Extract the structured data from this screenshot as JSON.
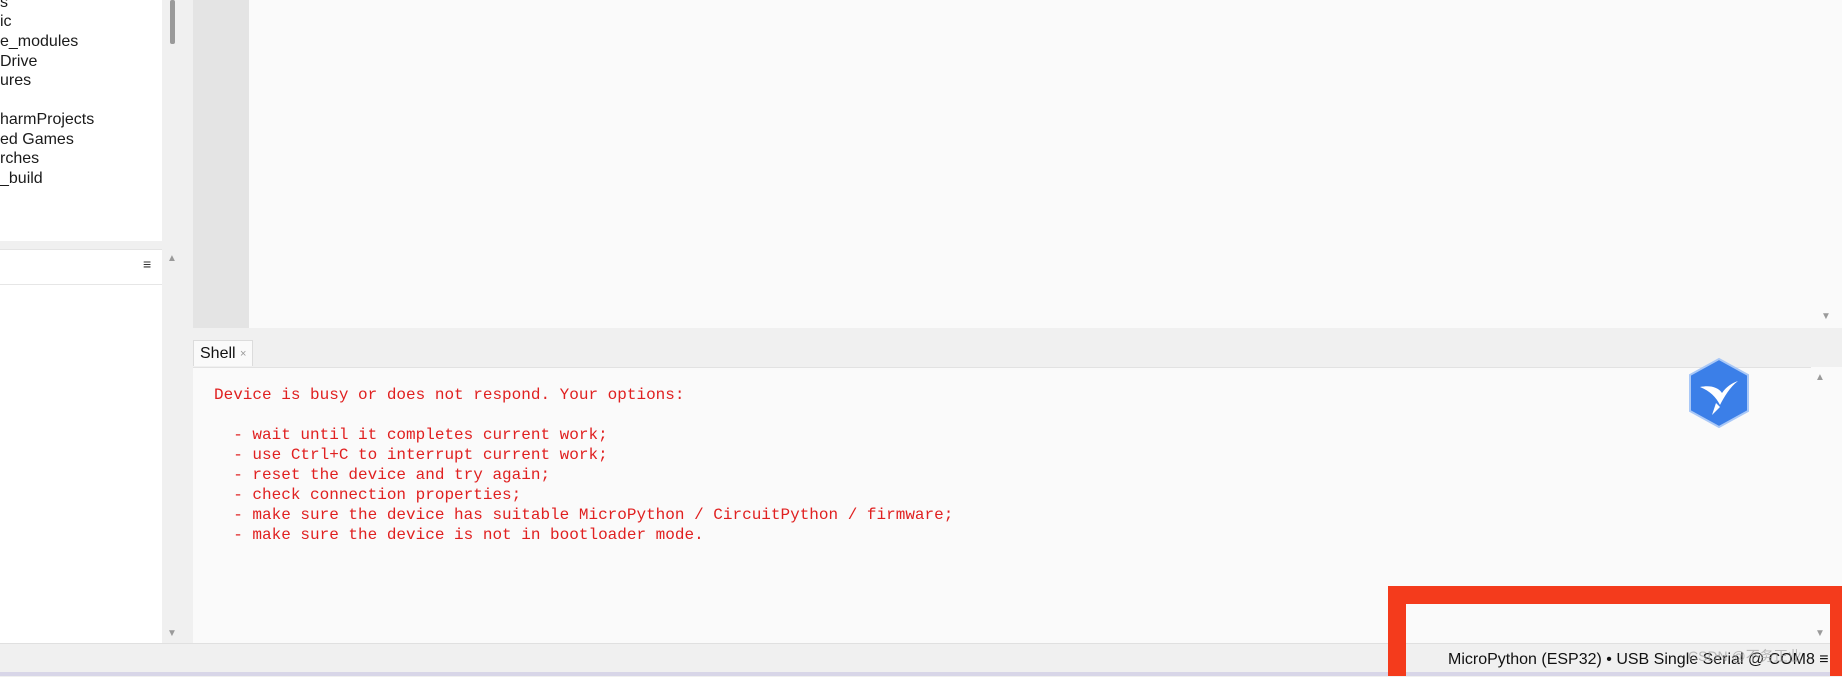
{
  "files": {
    "items": [
      "s",
      "ic",
      "e_modules",
      "Drive",
      "ures",
      "",
      "harmProjects",
      "ed Games",
      "rches",
      "_build"
    ]
  },
  "outline": {
    "menu_icon": "≡"
  },
  "shell": {
    "tab_label": "Shell",
    "tab_close": "×",
    "lines": [
      "Device is busy or does not respond. Your options:",
      "",
      "  - wait until it completes current work;",
      "  - use Ctrl+C to interrupt current work;",
      "  - reset the device and try again;",
      "  - check connection properties;",
      "  - make sure the device has suitable MicroPython / CircuitPython / firmware;",
      "  - make sure the device is not in bootloader mode."
    ],
    "text_color": "#e02020"
  },
  "status": {
    "interpreter": "MicroPython (ESP32)  •  USB Single Serial @ COM8 ≡"
  },
  "watermark": "CSDN @不务正业",
  "colors": {
    "highlight": "#f43b1c",
    "logo": "#3b7fe8"
  },
  "icons": {
    "logo": "bird-logo-icon",
    "scroll_up": "triangle-up-icon",
    "scroll_down": "triangle-down-icon",
    "menu": "hamburger-menu-icon"
  }
}
